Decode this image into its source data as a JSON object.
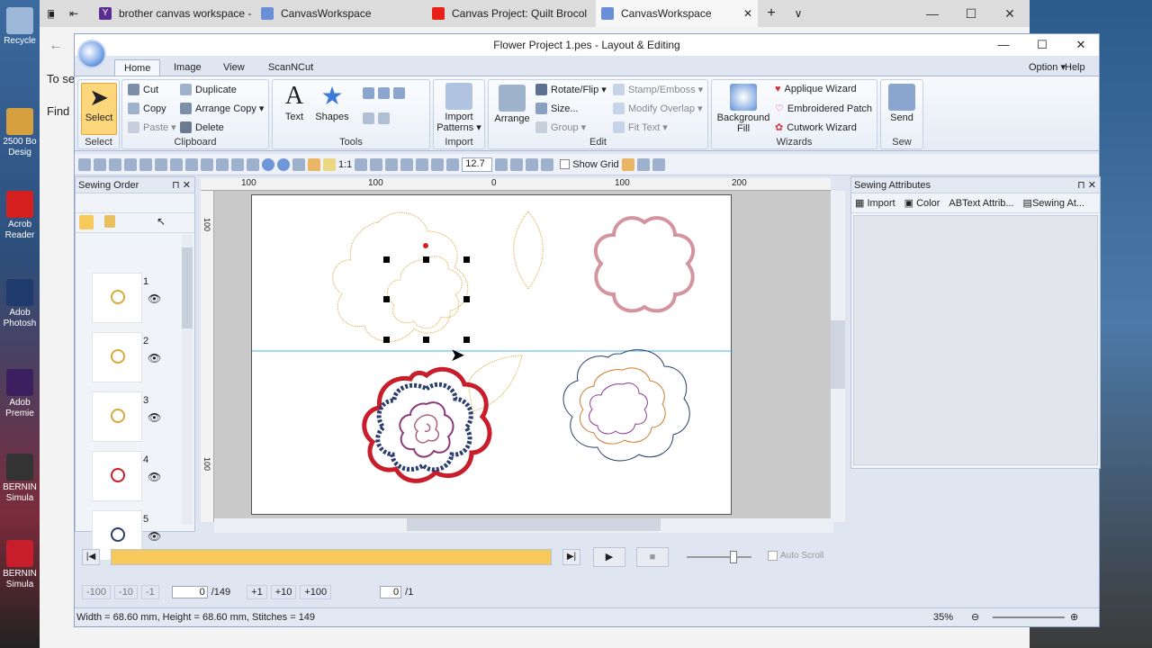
{
  "browser": {
    "tabs": [
      {
        "label": "brother canvas workspace -",
        "favicon_color": "#5c2d91"
      },
      {
        "label": "CanvasWorkspace",
        "favicon_color": "#6b8fd6"
      },
      {
        "label": "Canvas Project: Quilt Brocol",
        "favicon_color": "#e62117"
      },
      {
        "label": "CanvasWorkspace",
        "favicon_color": "#6b8fd6"
      }
    ],
    "new_tab": "+",
    "tab_menu": "∨",
    "minimize": "—",
    "maximize": "☐",
    "close": "✕",
    "back_text": "←",
    "partial_text_1": "To se",
    "partial_text_2": "Find"
  },
  "desktop": {
    "icons": [
      {
        "label": "Recycle",
        "color": "#9db8d8"
      },
      {
        "label": "2500 Bo Desig",
        "color": "#d6a040"
      },
      {
        "label": "Acrob Reader",
        "color": "#d62020"
      },
      {
        "label": "Adob Photosh",
        "color": "#1f3b6e"
      },
      {
        "label": "Adob Premie",
        "color": "#3b1f5e"
      },
      {
        "label": "BERNIN Simula",
        "color": "#333"
      },
      {
        "label": "BERNIN Simula",
        "color": "#c81e2b"
      }
    ]
  },
  "app": {
    "title": "Flower Project 1.pes - Layout & Editing",
    "minimize": "—",
    "maximize": "☐",
    "close": "✕",
    "ribbon_tabs": [
      "Home",
      "Image",
      "View",
      "ScanNCut"
    ],
    "option": "Option ▾",
    "help": "Help ▾",
    "groups": {
      "select": {
        "label": "Select",
        "button": "Select"
      },
      "clipboard": {
        "label": "Clipboard",
        "cut": "Cut",
        "copy": "Copy",
        "paste": "Paste ▾",
        "duplicate": "Duplicate",
        "arrange_copy": "Arrange Copy ▾",
        "delete": "Delete"
      },
      "tools": {
        "label": "Tools",
        "text": "Text",
        "shapes": "Shapes"
      },
      "import": {
        "label": "Import",
        "import_patterns": "Import Patterns ▾"
      },
      "edit": {
        "label": "Edit",
        "arrange": "Arrange",
        "rotate_flip": "Rotate/Flip ▾",
        "size": "Size...",
        "group": "Group ▾",
        "stamp_emboss": "Stamp/Emboss ▾",
        "modify_overlap": "Modify Overlap ▾",
        "fit_text": "Fit Text ▾"
      },
      "wizards": {
        "label": "Wizards",
        "background_fill": "Background Fill",
        "applique": "Applique Wizard",
        "embroidered_patch": "Embroidered Patch",
        "cutwork": "Cutwork Wizard"
      },
      "sew": {
        "label": "Sew",
        "send": "Send"
      }
    },
    "toolbar": {
      "scale": "1:1",
      "zoom_value": "12.7",
      "show_grid": "Show Grid"
    },
    "sewing_order": {
      "title": "Sewing Order",
      "items": [
        {
          "num": "1",
          "color": "#d9a93a"
        },
        {
          "num": "2",
          "color": "#d9a93a"
        },
        {
          "num": "3",
          "color": "#d9a93a"
        },
        {
          "num": "4",
          "color": "#c81e2b"
        },
        {
          "num": "5",
          "color": "#2a3d6e"
        }
      ]
    },
    "rulers": {
      "top": [
        "100",
        "0",
        "100",
        "200",
        "100",
        "0"
      ],
      "left": [
        "100",
        "100"
      ]
    },
    "sewing_attributes": {
      "title": "Sewing Attributes",
      "import": "Import",
      "color": "Color",
      "text_attrib": "Text Attrib...",
      "sewing_at": "Sewing At..."
    },
    "playback": {
      "auto_scroll": "Auto Scroll",
      "progress": 1.0
    },
    "stitch_nav": {
      "minus100": "-100",
      "minus10": "-10",
      "minus1": "-1",
      "current": "0",
      "total": "/149",
      "plus1": "+1",
      "plus10": "+10",
      "plus100": "+100",
      "color_current": "0",
      "color_total": "/1"
    },
    "status": {
      "text": "Width = 68.60 mm, Height = 68.60 mm, Stitches = 149",
      "zoom": "35%"
    }
  }
}
